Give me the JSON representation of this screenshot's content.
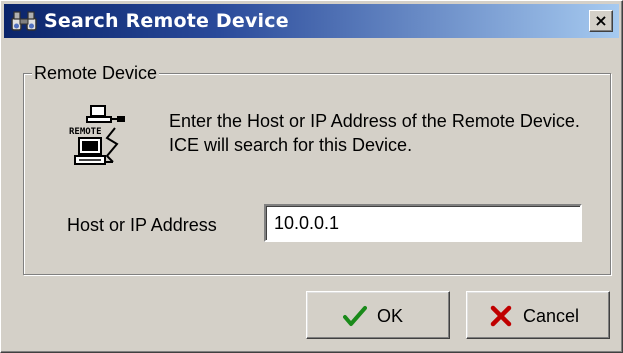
{
  "window": {
    "title": "Search Remote Device",
    "title_icon": "binoculars-icon",
    "close_label": "×"
  },
  "group": {
    "legend": "Remote Device",
    "icon": "remote-device-icon",
    "icon_text": "REMOTE",
    "description": "Enter the Host or IP Address of the Remote Device. ICE will search for this Device."
  },
  "host": {
    "label": "Host or IP Address",
    "value": "10.0.0.1"
  },
  "buttons": {
    "ok_label": "OK",
    "ok_icon": "checkmark-icon",
    "cancel_label": "Cancel",
    "cancel_icon": "x-mark-icon"
  },
  "colors": {
    "titlebar_start": "#0a246a",
    "titlebar_end": "#a6caf0",
    "dialog_bg": "#d4d0c8",
    "ok_icon_color": "#1a8a1a",
    "cancel_icon_color": "#c00000"
  }
}
